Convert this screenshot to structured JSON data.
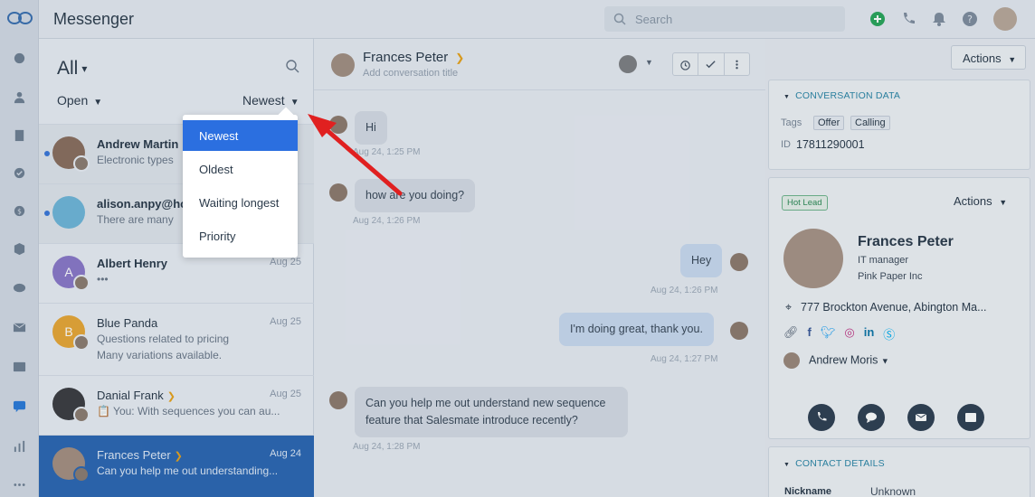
{
  "app": {
    "title": "Messenger"
  },
  "search": {
    "placeholder": "Search"
  },
  "list": {
    "filter": "All",
    "status_filter": "Open",
    "sort": "Newest",
    "conversations": [
      {
        "name": "Andrew Martin",
        "preview": "Electronic types",
        "date": "",
        "unread": true
      },
      {
        "name": "alison.anpy@ho",
        "preview": "There are many",
        "date": "",
        "unread": true
      },
      {
        "name": "Albert Henry",
        "initial": "A",
        "preview": "•••",
        "date": "Aug 25"
      },
      {
        "name": "Blue Panda",
        "initial": "B",
        "preview": "Questions related to pricing",
        "preview2": "Many variations available.",
        "date": "Aug 25"
      },
      {
        "name": "Danial Frank",
        "preview": "📋 You: With sequences you can au...",
        "date": "Aug 25"
      },
      {
        "name": "Frances Peter",
        "preview": "Can you help me out understanding...",
        "date": "Aug 24",
        "selected": true
      }
    ]
  },
  "sort_menu": {
    "options": [
      "Newest",
      "Oldest",
      "Waiting longest",
      "Priority"
    ],
    "selected": "Newest"
  },
  "chat": {
    "contact_name": "Frances Peter",
    "subtitle": "Add conversation title",
    "messages": [
      {
        "text": "Hi",
        "time": "Aug 24, 1:25 PM",
        "direction": "in"
      },
      {
        "text": "how are you doing?",
        "time": "Aug 24, 1:26 PM",
        "direction": "in"
      },
      {
        "text": "Hey",
        "time": "Aug 24, 1:26 PM",
        "direction": "out"
      },
      {
        "text": "I'm doing great, thank you.",
        "time": "Aug 24, 1:27 PM",
        "direction": "out"
      },
      {
        "text": "Can you help me out understand new sequence feature that Salesmate introduce recently?",
        "time": "Aug 24, 1:28 PM",
        "direction": "in"
      }
    ]
  },
  "details": {
    "actions_label": "Actions",
    "conversation_data_title": "CONVERSATION DATA",
    "tags_label": "Tags",
    "tags": [
      "Offer",
      "Calling"
    ],
    "id_label": "ID",
    "id_value": "17811290001",
    "badge": "Hot Lead",
    "contact": {
      "name": "Frances Peter",
      "title": "IT manager",
      "company": "Pink Paper Inc",
      "address": "777 Brockton Avenue, Abington Ma...",
      "owner": "Andrew Moris"
    },
    "contact_details_title": "CONTACT DETAILS",
    "nickname_label": "Nickname",
    "nickname_value": "Unknown"
  },
  "colors": {
    "accent": "#2b6fe0",
    "selected_row": "#2c67b2",
    "arrow": "#e02020",
    "chevron": "#e8a21c"
  }
}
